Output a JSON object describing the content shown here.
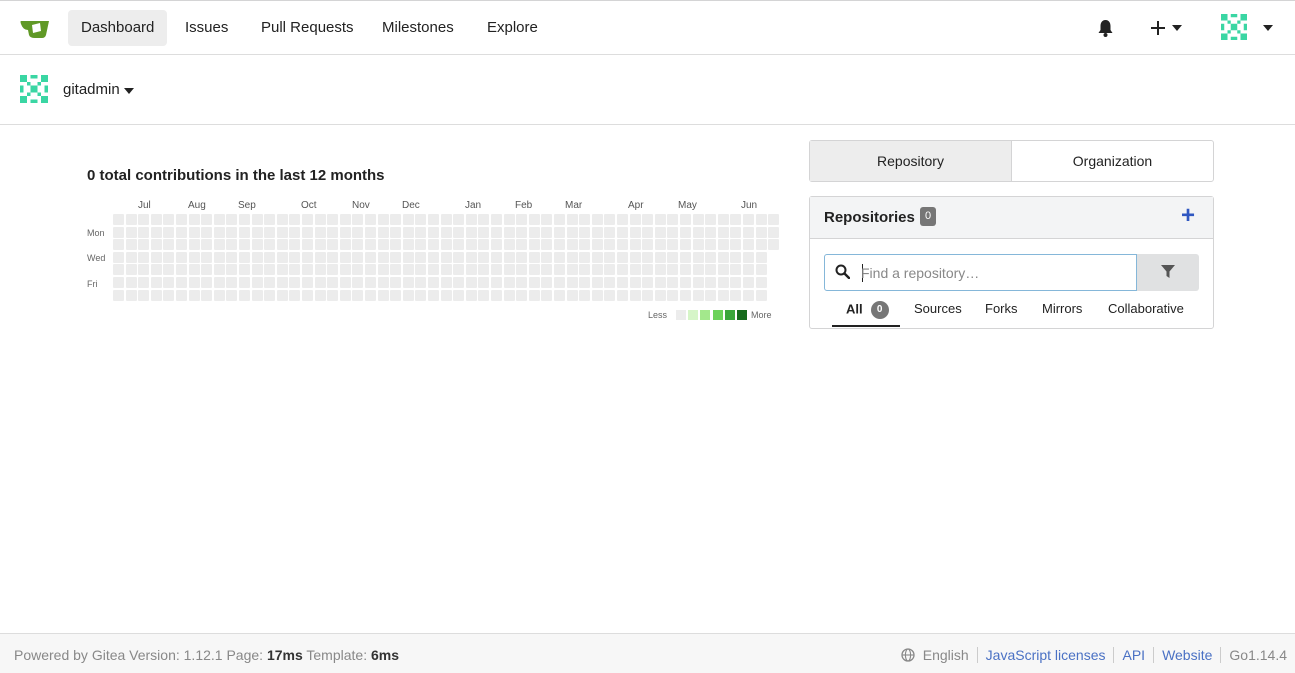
{
  "navbar": {
    "items": [
      {
        "label": "Dashboard",
        "active": true
      },
      {
        "label": "Issues"
      },
      {
        "label": "Pull Requests"
      },
      {
        "label": "Milestones"
      },
      {
        "label": "Explore"
      }
    ],
    "notification_icon": "bell-icon",
    "create_icon": "plus-icon",
    "logo_color": "#609926"
  },
  "user": {
    "name": "gitadmin",
    "avatar_color": "#3ad6a3"
  },
  "heatmap": {
    "title": "0 total contributions in the last 12 months",
    "months": [
      "Jul",
      "Aug",
      "Sep",
      "Oct",
      "Nov",
      "Dec",
      "Jan",
      "Feb",
      "Mar",
      "Apr",
      "May",
      "Jun"
    ],
    "days": [
      "Mon",
      "Wed",
      "Fri"
    ],
    "legend_less": "Less",
    "legend_more": "More",
    "legend_colors": [
      "#ececec",
      "#d6f5c8",
      "#a3e88c",
      "#6cd25a",
      "#3aa63a",
      "#176b1d"
    ],
    "total": 0
  },
  "switch": {
    "repository": "Repository",
    "organization": "Organization"
  },
  "repos": {
    "title": "Repositories",
    "count": "0",
    "search_placeholder": "Find a repository…",
    "tabs": [
      {
        "label": "All",
        "count": "0",
        "active": true
      },
      {
        "label": "Sources"
      },
      {
        "label": "Forks"
      },
      {
        "label": "Mirrors"
      },
      {
        "label": "Collaborative"
      }
    ],
    "accent": "#2f57c1"
  },
  "footer": {
    "powered": "Powered by Gitea Version: 1.12.1 Page:",
    "page_time": "17ms",
    "template_label": "Template:",
    "template_time": "6ms",
    "language": "English",
    "links": [
      "JavaScript licenses",
      "API",
      "Website"
    ],
    "go_version": "Go1.14.4"
  }
}
